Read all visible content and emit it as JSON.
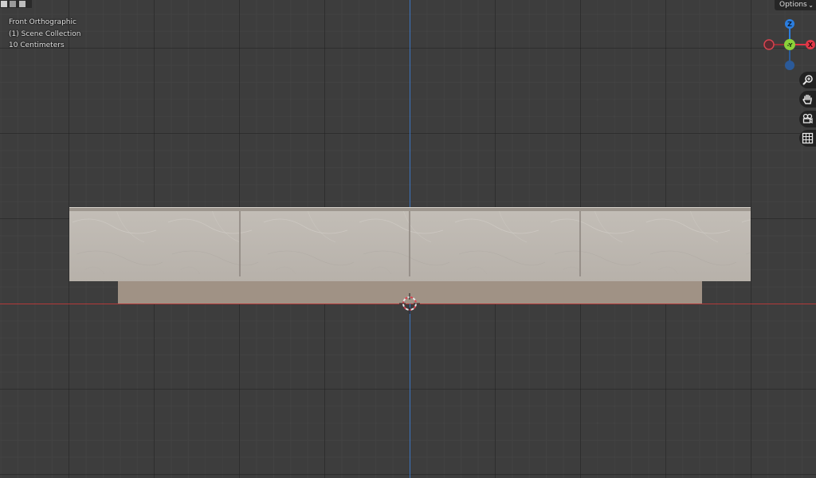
{
  "viewport": {
    "view_name": "Front Orthographic",
    "collection": "(1) Scene Collection",
    "scale": "10 Centimeters"
  },
  "header": {
    "options_label": "Options"
  },
  "gizmo": {
    "z_label": "Z",
    "y_label": "-Y",
    "x_label": "X",
    "x_color": "#e13747",
    "y_color": "#8bd13a",
    "z_color": "#2b7ee0"
  },
  "nav_buttons": {
    "icons": [
      "zoom-icon",
      "hand-icon",
      "camera-icon",
      "grid-icon"
    ]
  },
  "colors": {
    "background": "#3d3d3d",
    "x_axis_line": "#b33a3a",
    "z_axis_line": "#3b74c0",
    "cabinet_body": "#bcb7b0",
    "cabinet_base": "#a09285"
  }
}
